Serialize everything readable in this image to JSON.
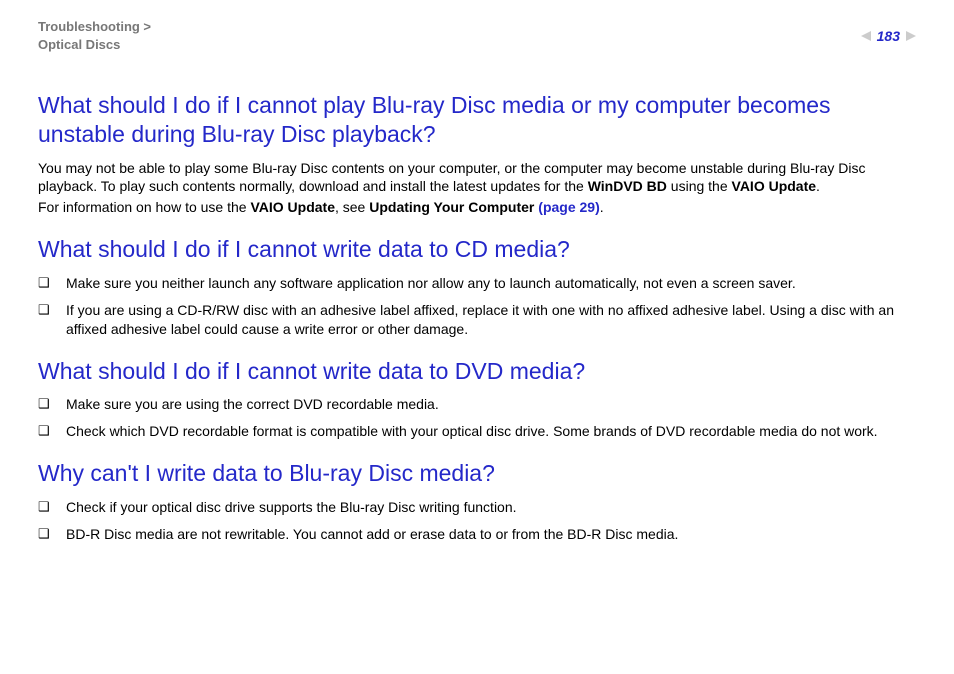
{
  "header": {
    "breadcrumb_line1": "Troubleshooting >",
    "breadcrumb_line2": "Optical Discs",
    "page_number": "183"
  },
  "sections": {
    "s1": {
      "heading": "What should I do if I cannot play Blu-ray Disc media or my computer becomes unstable during Blu-ray Disc playback?",
      "p1a": "You may not be able to play some Blu-ray Disc contents on your computer, or the computer may become unstable during Blu-ray Disc playback. To play such contents normally, download and install the latest updates for the ",
      "p1b": "WinDVD BD",
      "p1c": " using the ",
      "p1d": "VAIO Update",
      "p1e": ".",
      "p2a": "For information on how to use the ",
      "p2b": "VAIO Update",
      "p2c": ", see ",
      "p2d": "Updating Your Computer ",
      "p2e": "(page 29)",
      "p2f": "."
    },
    "s2": {
      "heading": "What should I do if I cannot write data to CD media?",
      "b1": "Make sure you neither launch any software application nor allow any to launch automatically, not even a screen saver.",
      "b2": "If you are using a CD-R/RW disc with an adhesive label affixed, replace it with one with no affixed adhesive label. Using a disc with an affixed adhesive label could cause a write error or other damage."
    },
    "s3": {
      "heading": "What should I do if I cannot write data to DVD media?",
      "b1": "Make sure you are using the correct DVD recordable media.",
      "b2": "Check which DVD recordable format is compatible with your optical disc drive. Some brands of DVD recordable media do not work."
    },
    "s4": {
      "heading": "Why can't I write data to Blu-ray Disc media?",
      "b1": "Check if your optical disc drive supports the Blu-ray Disc writing function.",
      "b2": "BD-R Disc media are not rewritable. You cannot add or erase data to or from the BD-R Disc media."
    }
  }
}
